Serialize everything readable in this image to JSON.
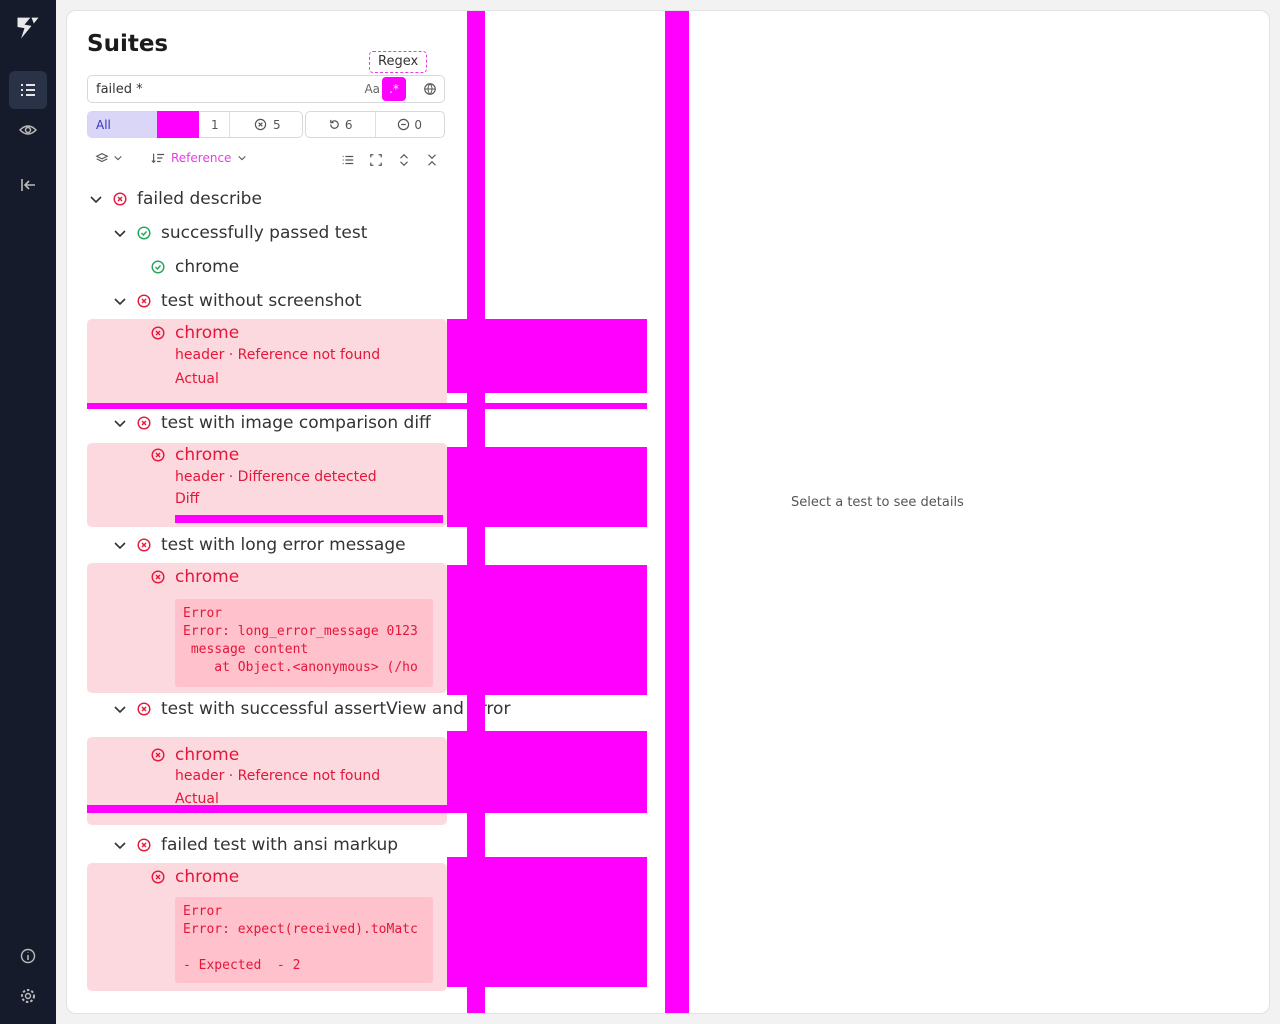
{
  "sidebar": {
    "items": [
      {
        "icon": "logo-icon"
      },
      {
        "icon": "suites-list-icon",
        "active": true
      },
      {
        "icon": "eye-icon"
      },
      {
        "icon": "collapse-sidebar-icon"
      },
      {
        "icon": "info-icon"
      },
      {
        "icon": "settings-icon"
      }
    ]
  },
  "header": {
    "title": "Suites"
  },
  "search": {
    "value": "failed *",
    "case_label": "Aa",
    "regex_tooltip": "Regex"
  },
  "filters": {
    "all_label": "All",
    "passed_count": "1",
    "failed_count": "5",
    "retried_count": "6",
    "skipped_count": "0"
  },
  "toolbar": {
    "group_label": "",
    "sort_label": "Reference"
  },
  "tree": {
    "suite": "failed describe",
    "items": [
      {
        "label": "successfully passed test",
        "status": "passed"
      },
      {
        "label": "chrome",
        "status": "passed"
      },
      {
        "label": "test without screenshot",
        "status": "failed"
      },
      {
        "label": "chrome",
        "status": "failed",
        "lines": [
          "header · Reference not found",
          "Actual"
        ]
      },
      {
        "label": "test with image comparison diff",
        "status": "failed"
      },
      {
        "label": "chrome",
        "status": "failed",
        "lines": [
          "header · Difference detected",
          "Diff"
        ]
      },
      {
        "label": "test with long error message",
        "status": "failed"
      },
      {
        "label": "chrome",
        "status": "failed",
        "code": "Error\nError: long_error_message 0123\n message content\n    at Object.<anonymous> (/ho"
      },
      {
        "label": "test with successful assertView and error",
        "status": "failed"
      },
      {
        "label": "chrome",
        "status": "failed",
        "lines": [
          "header · Reference not found",
          "Actual"
        ]
      },
      {
        "label": "failed test with ansi markup",
        "status": "failed"
      },
      {
        "label": "chrome",
        "status": "failed",
        "code": "Error\nError: expect(received).toMatc\n\n- Expected  - 2"
      }
    ]
  },
  "details": {
    "placeholder": "Select a test to see details"
  },
  "colors": {
    "sidebar_bg": "#151b2b",
    "fail": "#e5163a",
    "pass": "#1fa55a",
    "accent": "#3b30c4",
    "highlight": "#ff00ff"
  }
}
